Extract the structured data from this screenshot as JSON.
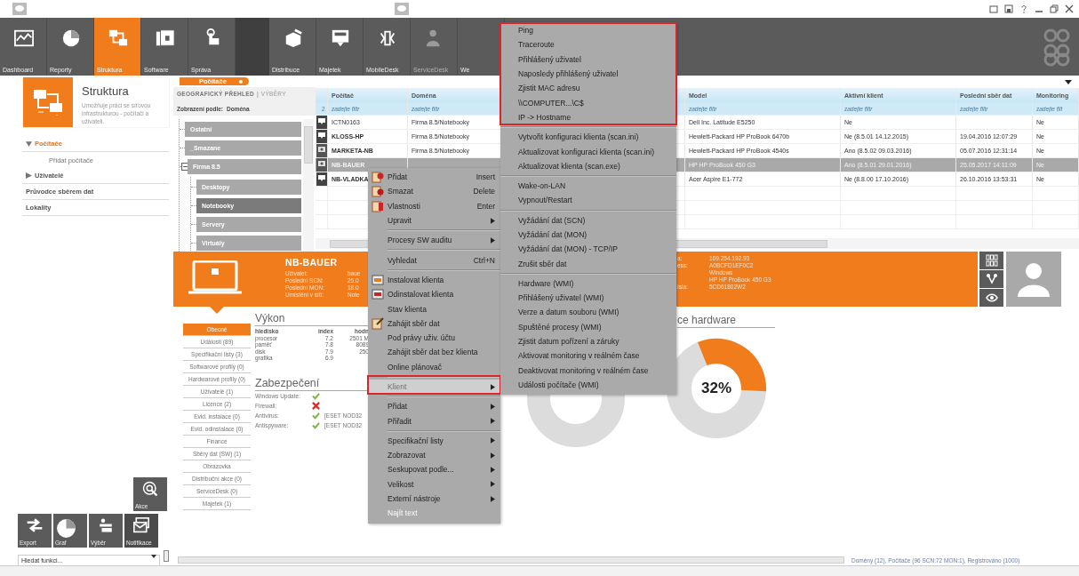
{
  "toolbar": {
    "groups": [
      {
        "items": [
          {
            "label": "Dashboard",
            "kind": "chart",
            "selected": false,
            "disabled": false
          },
          {
            "label": "Reporty",
            "kind": "pie",
            "selected": false,
            "disabled": false
          },
          {
            "label": "Struktura",
            "kind": "structure",
            "selected": true,
            "disabled": false
          },
          {
            "label": "Software",
            "kind": "folder",
            "selected": false,
            "disabled": false
          },
          {
            "label": "Správa",
            "kind": "hand",
            "selected": false,
            "disabled": false
          }
        ]
      },
      {
        "items": [
          {
            "label": "Distribuce",
            "kind": "box",
            "selected": false,
            "disabled": false
          },
          {
            "label": "Majetek",
            "kind": "device",
            "selected": false,
            "disabled": false
          },
          {
            "label": "MobileDesk",
            "kind": "mobile",
            "selected": false,
            "disabled": false
          },
          {
            "label": "ServiceDesk",
            "kind": "person",
            "selected": false,
            "disabled": true
          },
          {
            "label": "We",
            "selected": false,
            "disabled": false
          }
        ]
      }
    ]
  },
  "module": {
    "title": "Struktura",
    "description": "Umožňuje práci se síťovou infrastrukturou - počítači a uživateli."
  },
  "nav": [
    {
      "label": "Počítače",
      "selected": true,
      "expanded": true,
      "children": [
        {
          "label": "Přidat počítače",
          "selected": false
        }
      ]
    },
    {
      "label": "Uživatelé",
      "selected": false,
      "expanded": false
    },
    {
      "label": "Průvodce sběrem dat",
      "selected": false
    },
    {
      "label": "Lokality",
      "selected": false
    }
  ],
  "quick_actions": [
    {
      "label": "Akce",
      "kind": "target"
    }
  ],
  "bottom_actions": [
    {
      "label": "Export",
      "kind": "arrows"
    },
    {
      "label": "Graf",
      "kind": "pie"
    },
    {
      "label": "Výběr",
      "kind": "stack"
    },
    {
      "label": "Notifikace",
      "kind": "mail"
    }
  ],
  "function_search": {
    "placeholder": "Hledat funkci..."
  },
  "computers_panel": {
    "tab": "Počítače",
    "views": [
      {
        "label": "GEOGRAFICKÝ PŘEHLED",
        "selected": true
      },
      {
        "label": "VÝBĚRY",
        "selected": false
      }
    ],
    "view_separator": "|",
    "group_by_label": "Zobrazení podle:",
    "group_by_value": "Doména",
    "tree": [
      {
        "label": "Ostatní",
        "selected": false
      },
      {
        "label": "_Smazane",
        "selected": false
      },
      {
        "label": "Firma 8.5",
        "selected": false,
        "expanded": true,
        "children": [
          {
            "label": "Desktopy",
            "selected": false
          },
          {
            "label": "Notebooky",
            "selected": true
          },
          {
            "label": "Servery",
            "selected": false
          },
          {
            "label": "Virtuály",
            "selected": false
          }
        ]
      }
    ]
  },
  "table": {
    "filter_count": "2",
    "columns": [
      {
        "label": "Počítač",
        "placeholder": "zadejte filtr"
      },
      {
        "label": "Doména",
        "placeholder": "zadejte filtr"
      },
      {
        "label": "Model",
        "placeholder": "zadejte filtr"
      },
      {
        "label": "Aktivní klient",
        "placeholder": "zadejte filtr"
      },
      {
        "label": "Poslední sběr dat",
        "placeholder": "zadejte filtr"
      },
      {
        "label": "Monitoring",
        "placeholder": "zadejte filt"
      }
    ],
    "rows": [
      {
        "kind": "monitor",
        "selected": false,
        "bold": false,
        "cells": [
          "ICTN0163",
          "Firma 8.5/Notebooky",
          "Dell Inc. Latitude E5250",
          "Ne",
          null,
          "Ne"
        ]
      },
      {
        "kind": "monitor",
        "selected": false,
        "bold": true,
        "cells": [
          "KLOSS-HP",
          "Firma 8.5/Notebooky",
          "Hewlett-Packard HP ProBook 6470b",
          "Ne (8.5.01 14.12.2015)",
          "19.04.2016 12:07:29",
          "Ne"
        ]
      },
      {
        "kind": "monitor-eye",
        "selected": false,
        "bold": true,
        "cells": [
          "MARKETA-NB",
          "Firma 8.5/Notebooky",
          "Hewlett-Packard HP ProBook 4540s",
          "Ano (8.5.02 09.03.2016)",
          "05.07.2016 12:31:14",
          "Ne"
        ]
      },
      {
        "kind": "monitor-eye",
        "selected": true,
        "bold": true,
        "cells": [
          "NB-BAUER",
          null,
          "HP HP ProBook 450 G3",
          "Ano (8.5.01 29.01.2016)",
          "25.05.2017 14:11:09",
          "Ne"
        ]
      },
      {
        "kind": "monitor",
        "selected": false,
        "bold": true,
        "cells": [
          "NB-VLADKA",
          null,
          "Acer Aspire E1-772",
          "Ne (8.8.00 17.10.2016)",
          "26.10.2016 13:53:31",
          "Ne"
        ]
      }
    ]
  },
  "detail": {
    "name": "NB-BAUER",
    "fields": [
      {
        "label": "Uživatel:",
        "value": "baue"
      },
      {
        "label": "Poslední SCN:",
        "value": "25.0"
      },
      {
        "label": "Poslední MON:",
        "value": "18.0"
      },
      {
        "label": "Umístění v síti:",
        "value": "Note"
      }
    ],
    "fields_right": [
      {
        "label": "a:",
        "value": "169.254.192.93"
      },
      {
        "label": "ess:",
        "value": "A0BCFD1EF0C2"
      },
      {
        "value": "Windows"
      },
      {
        "value": "HP HP ProBook 450 G3"
      },
      {
        "label": "ísla:",
        "value": "5CD61802W2"
      }
    ]
  },
  "detail_tabs": [
    {
      "label": "Obecné",
      "selected": true
    },
    {
      "label": "Události (89)",
      "selected": false
    },
    {
      "label": "Specifikační listy (3)",
      "selected": false
    },
    {
      "label": "Softwarové profily (0)",
      "selected": false
    },
    {
      "label": "Hardwarové profily (0)",
      "selected": false
    },
    {
      "label": "Uživatelé (1)",
      "selected": false
    },
    {
      "label": "Licence (2)",
      "selected": false
    },
    {
      "label": "Evid. instalace (0)",
      "selected": false
    },
    {
      "label": "Evid. odinstalace (0)",
      "selected": false
    },
    {
      "label": "Finance",
      "selected": false
    },
    {
      "label": "Sběry dat (SW) (1)",
      "selected": false
    },
    {
      "label": "Obrazovka",
      "selected": false
    },
    {
      "label": "Distribuční akce (0)",
      "selected": false
    },
    {
      "label": "ServiceDesk (0)",
      "selected": false
    },
    {
      "label": "Majetek (1)",
      "selected": false
    }
  ],
  "performance": {
    "title": "Výkon",
    "columns": [
      "hledisko",
      "index",
      "hodn"
    ],
    "rows": [
      [
        "procesor",
        "7.2",
        "2501 M"
      ],
      [
        "paměť",
        "7.8",
        "8089"
      ],
      [
        "disk",
        "7.9",
        "250"
      ],
      [
        "grafika",
        "6.9"
      ]
    ]
  },
  "security": {
    "title": "Zabezpečení",
    "items": [
      {
        "label": "Windows Update:",
        "ok": true
      },
      {
        "label": "Firewall:",
        "ok": false
      },
      {
        "label": "Antivirus:",
        "ok": true,
        "value": "[ESET NOD32"
      },
      {
        "label": "Antispyware:",
        "ok": true,
        "value": "[ESET NOD32"
      }
    ]
  },
  "hardware_chart": {
    "title": "ce hardware",
    "value_label": "32%",
    "level": 0.32
  },
  "status_bar": {
    "text": "Domény (12), Počítače (96 SCN:72 MON:1), Registrováno (1000)"
  },
  "context_menu": {
    "groups": [
      {
        "annotated": false,
        "items": [
          {
            "label": "Přidat",
            "kind": "add",
            "shortcut": "Insert",
            "submenu": false,
            "highlighted": false,
            "disabled": false
          },
          {
            "label": "Smazat",
            "kind": "delete",
            "shortcut": "Delete",
            "submenu": false,
            "highlighted": false,
            "disabled": false
          },
          {
            "label": "Vlastnosti",
            "kind": "properties",
            "shortcut": "Enter",
            "submenu": false,
            "highlighted": false,
            "disabled": false
          },
          {
            "label": "Upravit",
            "submenu": true,
            "highlighted": false,
            "disabled": false
          }
        ]
      },
      {
        "annotated": false,
        "items": [
          {
            "label": "Procesy SW auditu",
            "submenu": true,
            "highlighted": false,
            "disabled": false
          }
        ]
      },
      {
        "annotated": false,
        "items": [
          {
            "label": "Vyhledat",
            "shortcut": "Ctrl+N",
            "submenu": false,
            "highlighted": false,
            "disabled": false
          }
        ]
      },
      {
        "annotated": false,
        "items": [
          {
            "label": "Instalovat klienta",
            "kind": "install",
            "submenu": false,
            "highlighted": false,
            "disabled": false
          },
          {
            "label": "Odinstalovat klienta",
            "kind": "uninstall",
            "submenu": false,
            "highlighted": false,
            "disabled": false
          },
          {
            "label": "Stav klienta",
            "submenu": false,
            "highlighted": false,
            "disabled": false
          },
          {
            "label": "Zahájit sběr dat",
            "kind": "collect",
            "submenu": false,
            "highlighted": false,
            "disabled": false
          },
          {
            "label": "Pod právy uživ. účtu",
            "submenu": false,
            "highlighted": false,
            "disabled": false
          },
          {
            "label": "Zahájit sběr dat bez klienta",
            "submenu": false,
            "highlighted": false,
            "disabled": false
          },
          {
            "label": "Online plánovač",
            "submenu": false,
            "highlighted": false,
            "disabled": false
          }
        ]
      },
      {
        "annotated": true,
        "items": [
          {
            "label": "Klient",
            "submenu": true,
            "highlighted": true,
            "disabled": false
          }
        ]
      },
      {
        "annotated": false,
        "items": [
          {
            "label": "Přidat",
            "submenu": true,
            "highlighted": false,
            "disabled": false
          },
          {
            "label": "Přiřadit",
            "submenu": true,
            "highlighted": false,
            "disabled": false
          }
        ]
      },
      {
        "annotated": false,
        "items": [
          {
            "label": "Specifikační listy",
            "submenu": true,
            "highlighted": false,
            "disabled": false
          },
          {
            "label": "Zobrazovat",
            "submenu": true,
            "highlighted": false,
            "disabled": false
          },
          {
            "label": "Seskupovat podle...",
            "submenu": true,
            "highlighted": false,
            "disabled": false
          },
          {
            "label": "Velikost",
            "submenu": true,
            "highlighted": false,
            "disabled": false
          },
          {
            "label": "Externí nástroje",
            "submenu": true,
            "highlighted": false,
            "disabled": false
          },
          {
            "label": "Najít text",
            "submenu": false,
            "highlighted": false,
            "disabled": true
          }
        ]
      }
    ]
  },
  "submenu": {
    "groups": [
      {
        "annotated": true,
        "items": [
          "Ping",
          "Traceroute",
          "Přihlášený uživatel",
          "Naposledy přihlášený uživatel",
          "Zjistit MAC adresu",
          "\\\\COMPUTER...\\C$",
          "IP -> Hostname"
        ]
      },
      {
        "annotated": false,
        "items": [
          "Vytvořit konfiguraci klienta (scan.ini)",
          "Aktualizovat konfiguraci klienta (scan.ini)",
          "Aktualizovat klienta (scan.exe)"
        ]
      },
      {
        "annotated": false,
        "items": [
          "Wake-on-LAN",
          "Vypnout/Restart"
        ]
      },
      {
        "annotated": false,
        "items": [
          "Vyžádání dat (SCN)",
          "Vyžádání dat (MON)",
          "Vyžádání dat (MON) - TCP/IP",
          "Zrušit sběr dat"
        ]
      },
      {
        "annotated": false,
        "items": [
          "Hardware (WMI)",
          "Přihlášený uživatel (WMI)",
          "Verze a datum souboru (WMI)",
          "Spuštěné procesy (WMI)",
          "Zjistit datum pořízení a záruky",
          "Aktivovat monitoring v reálném čase",
          "Deaktivovat monitoring v reálném čase",
          "Události počítače (WMI)"
        ]
      }
    ]
  }
}
